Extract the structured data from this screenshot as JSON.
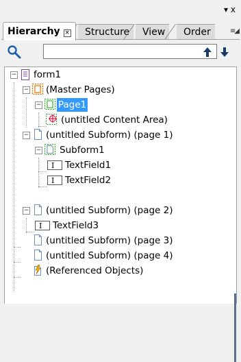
{
  "panel": {
    "menu_glyph": "▾ x"
  },
  "tabs": [
    {
      "label": "Hierarchy",
      "active": true
    },
    {
      "label": "Structure",
      "active": false
    },
    {
      "label": "View",
      "active": false
    },
    {
      "label": "Order",
      "active": false
    }
  ],
  "search": {
    "value": "",
    "placeholder": ""
  },
  "tree": {
    "items": [
      {
        "label": "form1",
        "icon": "form-icon"
      },
      {
        "label": "(Master Pages)",
        "icon": "master-pages-icon"
      },
      {
        "label": "Page1",
        "icon": "page-icon",
        "selected": true
      },
      {
        "label": "(untitled Content Area)",
        "icon": "content-area-icon"
      },
      {
        "label": "(untitled Subform) (page 1)",
        "icon": "subform-page-icon"
      },
      {
        "label": "Subform1",
        "icon": "subform-icon"
      },
      {
        "label": "TextField1",
        "icon": "textfield-icon"
      },
      {
        "label": "TextField2",
        "icon": "textfield-icon"
      },
      {
        "label": "(untitled Subform) (page 2)",
        "icon": "subform-page-icon"
      },
      {
        "label": "TextField3",
        "icon": "textfield-icon"
      },
      {
        "label": "(untitled Subform) (page 3)",
        "icon": "subform-page-icon"
      },
      {
        "label": "(untitled Subform) (page 4)",
        "icon": "subform-page-icon"
      },
      {
        "label": "(Referenced Objects)",
        "icon": "referenced-objects-icon"
      }
    ]
  },
  "colors": {
    "selection": "#3399ff",
    "master_pages_dashed": "#d06000",
    "page_dashed": "#2e9e2e",
    "content_area": "#cc0033"
  }
}
